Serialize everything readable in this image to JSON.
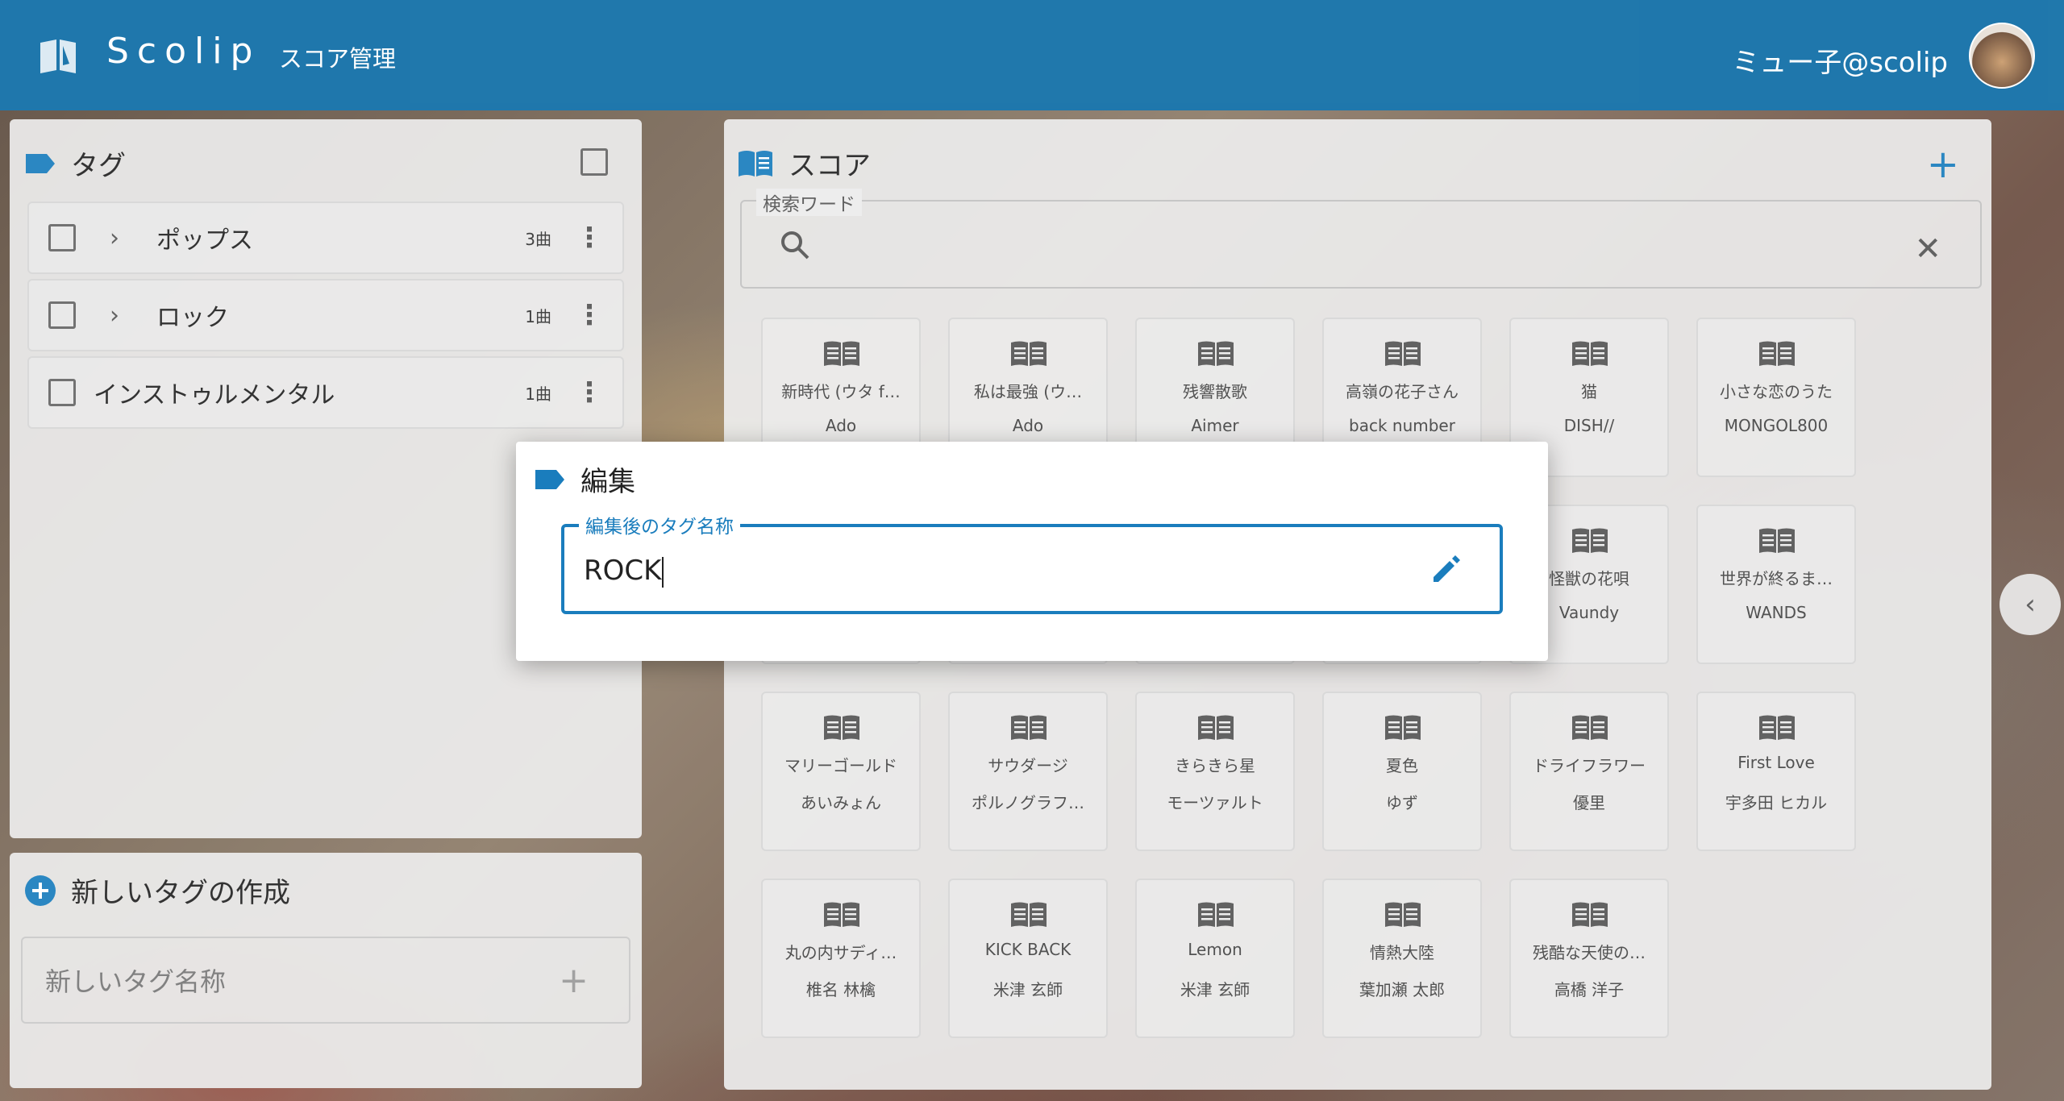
{
  "appbar": {
    "logo_text": "Scolip",
    "nav_title": "スコア管理",
    "user_name": "ミュー子@scolip"
  },
  "colors": {
    "primary": "#0d6ca5",
    "accent": "#1a7dbd"
  },
  "tag_panel": {
    "title": "タグ",
    "tags": [
      {
        "name": "ポップス",
        "count": "3曲",
        "expandable": true
      },
      {
        "name": "ロック",
        "count": "1曲",
        "expandable": true
      },
      {
        "name": "インストゥルメンタル",
        "count": "1曲",
        "expandable": false
      }
    ]
  },
  "new_tag_panel": {
    "title": "新しいタグの作成",
    "placeholder": "新しいタグ名称"
  },
  "score_panel": {
    "title": "スコア",
    "search_label": "検索ワード",
    "search_value": "",
    "scores": [
      {
        "title": "新時代 (ウタ f…",
        "artist": "Ado"
      },
      {
        "title": "私は最強 (ウ…",
        "artist": "Ado"
      },
      {
        "title": "残響散歌",
        "artist": "Aimer"
      },
      {
        "title": "高嶺の花子さん",
        "artist": "back number"
      },
      {
        "title": "猫",
        "artist": "DISH//"
      },
      {
        "title": "小さな恋のうた",
        "artist": "MONGOL800"
      },
      {
        "title": "",
        "artist": ""
      },
      {
        "title": "",
        "artist": ""
      },
      {
        "title": "",
        "artist": ""
      },
      {
        "title": "",
        "artist": ""
      },
      {
        "title": "怪獣の花唄",
        "artist": "Vaundy"
      },
      {
        "title": "世界が終るま…",
        "artist": "WANDS"
      },
      {
        "title": "マリーゴールド",
        "artist": "あいみょん"
      },
      {
        "title": "サウダージ",
        "artist": "ポルノグラフ…"
      },
      {
        "title": "きらきら星",
        "artist": "モーツァルト"
      },
      {
        "title": "夏色",
        "artist": "ゆず"
      },
      {
        "title": "ドライフラワー",
        "artist": "優里"
      },
      {
        "title": "First Love",
        "artist": "宇多田 ヒカル"
      },
      {
        "title": "丸の内サディ…",
        "artist": "椎名 林檎"
      },
      {
        "title": "KICK BACK",
        "artist": "米津 玄師"
      },
      {
        "title": "Lemon",
        "artist": "米津 玄師"
      },
      {
        "title": "情熱大陸",
        "artist": "葉加瀬 太郎"
      },
      {
        "title": "残酷な天使の…",
        "artist": "高橋 洋子"
      }
    ]
  },
  "edit_dialog": {
    "title": "編集",
    "field_label": "編集後のタグ名称",
    "field_value": "ROCK"
  }
}
